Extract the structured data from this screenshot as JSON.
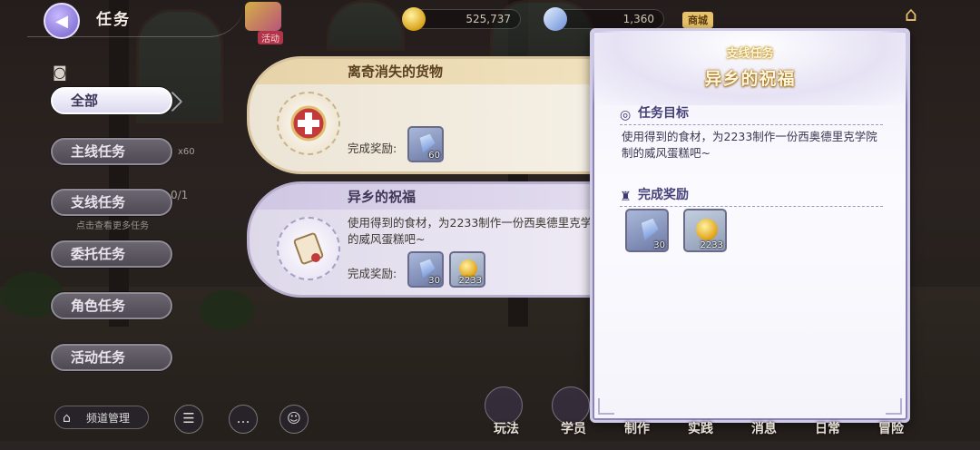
{
  "header": {
    "title": "任务",
    "event_label": "活动",
    "currencies": [
      {
        "icon": "gold-coin-icon",
        "value": "525,737"
      },
      {
        "icon": "crystal-icon",
        "value": "1,360"
      }
    ],
    "shop_label": "商城"
  },
  "sidebar": {
    "tabs": [
      {
        "label": "全部",
        "active": true
      },
      {
        "label": "主线任务",
        "active": false
      },
      {
        "label": "支线任务",
        "active": false
      },
      {
        "label": "委托任务",
        "active": false
      },
      {
        "label": "角色任务",
        "active": false
      },
      {
        "label": "活动任务",
        "active": false
      }
    ],
    "count_text": "0/1",
    "x60_text": "x60",
    "hint_text": "点击查看更多任务"
  },
  "quests": [
    {
      "title": "离奇消失的货物",
      "description": "",
      "reward_label": "完成奖励:",
      "rewards": [
        {
          "type": "crystal",
          "qty": "60"
        }
      ]
    },
    {
      "title": "异乡的祝福",
      "description": "使用得到的食材，为2233制作一份西奥德里克学院制的威风蛋糕吧~",
      "reward_label": "完成奖励:",
      "rewards": [
        {
          "type": "crystal",
          "qty": "30"
        },
        {
          "type": "coin",
          "qty": "2233"
        }
      ]
    }
  ],
  "detail": {
    "category": "支线任务",
    "title": "异乡的祝福",
    "objective_heading": "任务目标",
    "objective_text": "使用得到的食材，为2233制作一份西奥德里克学院制的威风蛋糕吧~",
    "reward_heading": "完成奖励",
    "rewards": [
      {
        "type": "crystal",
        "qty": "30"
      },
      {
        "type": "coin",
        "qty": "2233"
      }
    ]
  },
  "bottom": {
    "channel_label": "频道管理",
    "nav": [
      "玩法",
      "学员",
      "制作",
      "实践",
      "消息",
      "日常",
      "冒险"
    ]
  }
}
